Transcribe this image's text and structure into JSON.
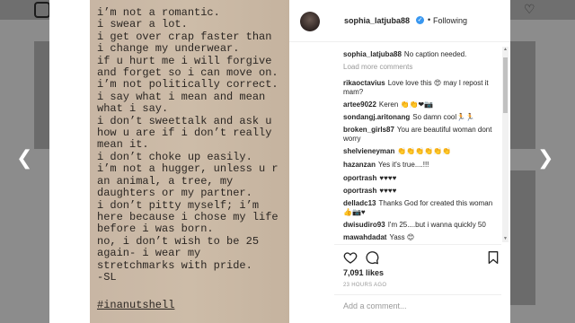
{
  "nav": {
    "prev_icon": "chevron-left",
    "next_icon": "chevron-right"
  },
  "post": {
    "text": "i’m not a romantic.\ni swear a lot.\ni get over crap faster than\ni change my underwear.\nif u hurt me i will forgive\nand forget so i can move on.\ni’m not politically correct.\ni say what i mean and mean\nwhat i say.\ni don’t sweettalk and ask u\nhow u are if i don’t really\nmean it.\ni don’t choke up easily.\ni’m not a hugger, unless u r\nan animal, a tree, my\ndaughters or my partner.\ni don’t pitty myself; i’m\nhere because i chose my life\nbefore i was born.\nno, i don’t wish to be 25\nagain- i wear my\nstretchmarks with pride.\n-SL",
    "hashtag": "#inanutshell"
  },
  "header": {
    "username": "sophia_latjuba88",
    "separator": "•",
    "follow_label": "Following"
  },
  "caption": {
    "user": "sophia_latjuba88",
    "text": "No caption needed."
  },
  "load_more": "Load more comments",
  "comments": [
    {
      "user": "rikaoctavius",
      "text": "Love love this 😍 may I repost it mam?"
    },
    {
      "user": "artee9022",
      "text": "Keren 👏👏❤📷"
    },
    {
      "user": "sondangj.aritonang",
      "text": "So damn cool🏃🏃"
    },
    {
      "user": "broken_girls87",
      "text": "You are beautiful woman dont worry"
    },
    {
      "user": "shelvieneyman",
      "text": "👏👏👏👏👏👏"
    },
    {
      "user": "hazanzan",
      "text": "Yes it's true....!!!"
    },
    {
      "user": "oportrash",
      "text": "♥♥♥♥"
    },
    {
      "user": "oportrash",
      "text": "♥♥♥♥"
    },
    {
      "user": "delladc13",
      "text": "Thanks God for created this woman 👍📷♥"
    },
    {
      "user": "dwisudiro93",
      "text": "I'm 25....but i wanna quickly 50"
    },
    {
      "user": "mawahdadat",
      "text": "Yass 😊"
    }
  ],
  "likes": "7,091 likes",
  "timestamp": "23 HOURS AGO",
  "add_comment_placeholder": "Add a comment..."
}
